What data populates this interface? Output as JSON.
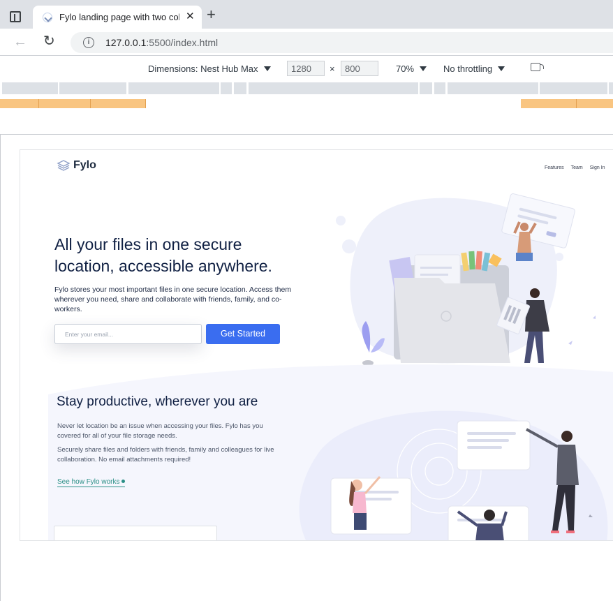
{
  "browser": {
    "tab_title": "Fylo landing page with two colur",
    "tab_close": "✕",
    "new_tab": "+",
    "url_host": "127.0.0.1",
    "url_path": ":5500/index.html"
  },
  "devtools": {
    "dimensions_label": "Dimensions: Nest Hub Max",
    "width": "1280",
    "times": "×",
    "height": "800",
    "zoom": "70%",
    "throttling": "No throttling"
  },
  "page": {
    "logo_text": "Fylo",
    "nav": [
      "Features",
      "Team",
      "Sign In"
    ],
    "hero": {
      "title": "All your files in one secure location, accessible anywhere.",
      "text": "Fylo stores your most important files in one secure location. Access them wherever you need, share and collaborate with friends, family, and co-workers.",
      "email_placeholder": "Enter your email...",
      "cta": "Get Started"
    },
    "features": {
      "title": "Stay productive, wherever you are",
      "paragraph1": "Never let location be an issue when accessing your files. Fylo has you covered for all of your file storage needs.",
      "paragraph2": "Securely share files and folders with friends, family and colleagues for live collaboration. No email attachments required!",
      "link": "See how Fylo works"
    }
  },
  "colors": {
    "accent": "#3a6df0",
    "link": "#2a8f86",
    "heading": "#102043"
  }
}
